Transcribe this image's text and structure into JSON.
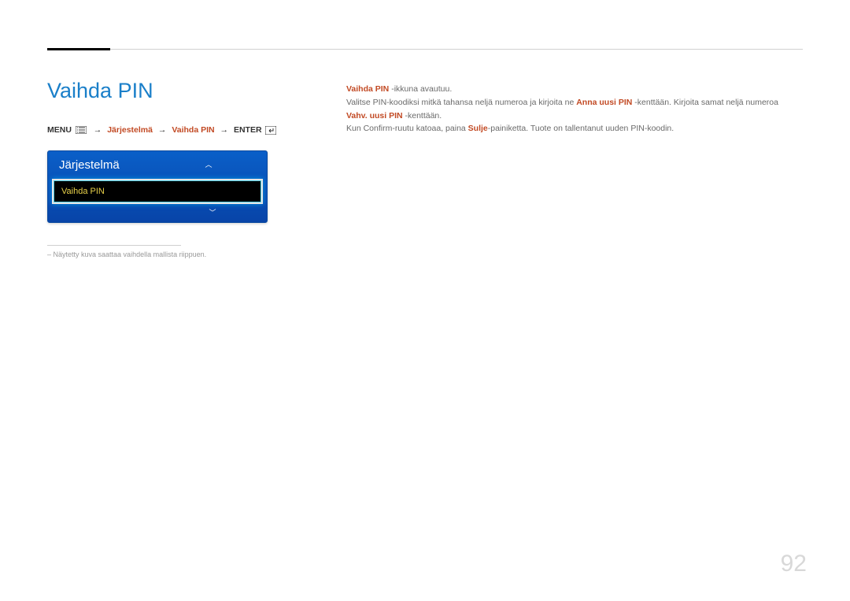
{
  "heading": "Vaihda PIN",
  "breadcrumb": {
    "menu": "MENU",
    "path1": "Järjestelmä",
    "path2": "Vaihda PIN",
    "enter": "ENTER"
  },
  "menu": {
    "title": "Järjestelmä",
    "item": "Vaihda PIN"
  },
  "note": "Näytetty kuva saattaa vaihdella mallista riippuen.",
  "body": {
    "p1a": "Vaihda PIN",
    "p1b": " -ikkuna avautuu.",
    "p2a": "Valitse PIN-koodiksi mitkä tahansa neljä numeroa ja kirjoita ne ",
    "p2b": "Anna uusi PIN",
    "p2c": " -kenttään. Kirjoita samat neljä numeroa ",
    "p3a": "Vahv. uusi PIN",
    "p3b": " -kenttään.",
    "p4a": "Kun Confirm-ruutu katoaa, paina ",
    "p4b": "Sulje",
    "p4c": "-painiketta. Tuote on tallentanut uuden PIN-koodin."
  },
  "page": "92"
}
